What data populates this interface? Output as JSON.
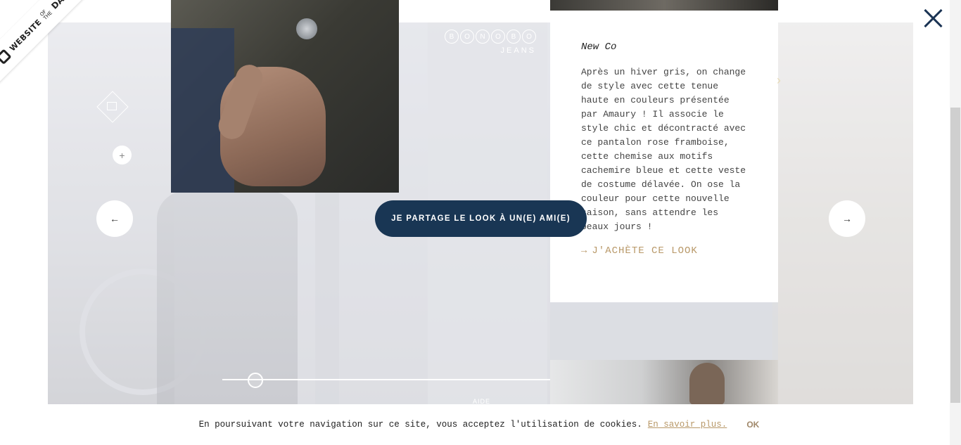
{
  "badge": {
    "main": "WEBSITE",
    "of": "OF",
    "the": "THE",
    "day": "DAY"
  },
  "brand": {
    "letters": [
      "B",
      "O",
      "N",
      "O",
      "B",
      "O"
    ],
    "sub": "JEANS"
  },
  "card": {
    "title": "New Co",
    "body": "Après un hiver gris, on change de style avec cette tenue haute en couleurs présentée par Amaury ! Il associe le style chic et décontracté avec ce pantalon rose framboise, cette chemise aux motifs cachemire bleue et cette veste de costume délavée. On ose la couleur pour cette nouvelle saison, sans attendre les beaux jours !",
    "cta_arrow": "→",
    "cta": "J'ACHÈTE CE LOOK"
  },
  "share_button": "JE PARTAGE LE LOOK À UN(E) AMI(E)",
  "nav": {
    "prev": "←",
    "next": "→",
    "plus": "+",
    "chevron": "›"
  },
  "slider": {
    "help": "AIDE",
    "position": 0.1
  },
  "cookie": {
    "text": "En poursuivant votre navigation sur ce site, vous acceptez l'utilisation de cookies.",
    "link": "En savoir plus.",
    "ok": "OK"
  },
  "colors": {
    "accent": "#193654",
    "gold": "#b89868"
  },
  "icons": {
    "close": "close-icon",
    "prev": "arrow-left-icon",
    "next": "arrow-right-icon"
  }
}
